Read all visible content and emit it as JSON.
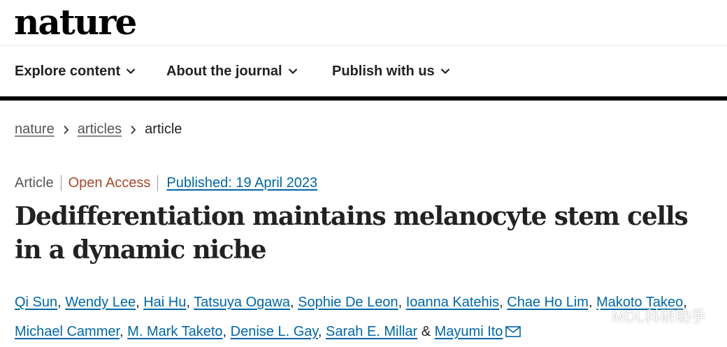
{
  "header": {
    "logo_text": "nature"
  },
  "nav": {
    "items": [
      {
        "label": "Explore content"
      },
      {
        "label": "About the journal"
      },
      {
        "label": "Publish with us"
      }
    ]
  },
  "breadcrumb": {
    "items": [
      "nature",
      "articles"
    ],
    "current": "article"
  },
  "article": {
    "type": "Article",
    "access": "Open Access",
    "published": "Published: 19 April 2023",
    "title": "Dedifferentiation maintains melanocyte stem cells in a dynamic niche",
    "authors": [
      "Qi Sun",
      "Wendy Lee",
      "Hai Hu",
      "Tatsuya Ogawa",
      "Sophie De Leon",
      "Ioanna Katehis",
      "Chae Ho Lim",
      "Makoto Takeo",
      "Michael Cammer",
      "M. Mark Taketo",
      "Denise L. Gay",
      "Sarah E. Millar",
      "Mayumi Ito"
    ],
    "separator": ", ",
    "final_joiner": " & "
  },
  "watermark": {
    "text": "MDL科研助手",
    "icon": "wechat-icon"
  },
  "colors": {
    "link": "#0067a5",
    "open_access": "#a8482c",
    "text": "#222222"
  }
}
